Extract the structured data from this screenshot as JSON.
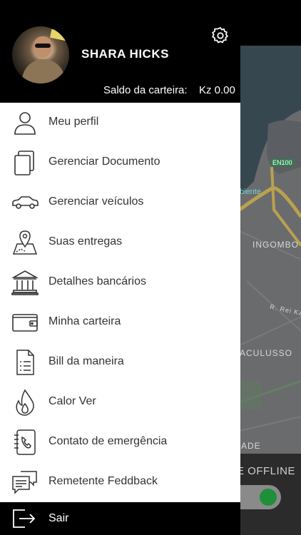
{
  "header": {
    "user_name": "SHARA HICKS",
    "wallet_label": "Saldo da carteira:",
    "wallet_value": "Kz 0.00",
    "settings_icon": "gear-icon"
  },
  "menu": [
    {
      "label": "Meu perfil",
      "icon": "user-icon"
    },
    {
      "label": "Gerenciar Documento",
      "icon": "documents-icon"
    },
    {
      "label": "Gerenciar veículos",
      "icon": "car-icon"
    },
    {
      "label": "Suas entregas",
      "icon": "map-pin-icon"
    },
    {
      "label": "Detalhes bancários",
      "icon": "bank-icon"
    },
    {
      "label": "Minha carteira",
      "icon": "wallet-icon"
    },
    {
      "label": "Bill da maneira",
      "icon": "bill-icon"
    },
    {
      "label": "Calor Ver",
      "icon": "flame-icon"
    },
    {
      "label": "Contato de emergência",
      "icon": "phone-book-icon"
    },
    {
      "label": "Remetente Feddback",
      "icon": "chat-icon"
    }
  ],
  "logout": {
    "label": "Sair",
    "icon": "logout-icon"
  },
  "map": {
    "road_badge": "EN100",
    "poi_label": "biente",
    "area_1": "INGOMBO",
    "street_1": "R. Rei Kat",
    "area_2": "ACULUSSO",
    "area_3": "ADE"
  },
  "status": {
    "offline_text": "E OFFLINE"
  },
  "colors": {
    "header_bg": "#000000",
    "drawer_bg": "#ffffff",
    "toggle_on": "#1f8f3a",
    "map_bg": "#6a6b6d"
  }
}
